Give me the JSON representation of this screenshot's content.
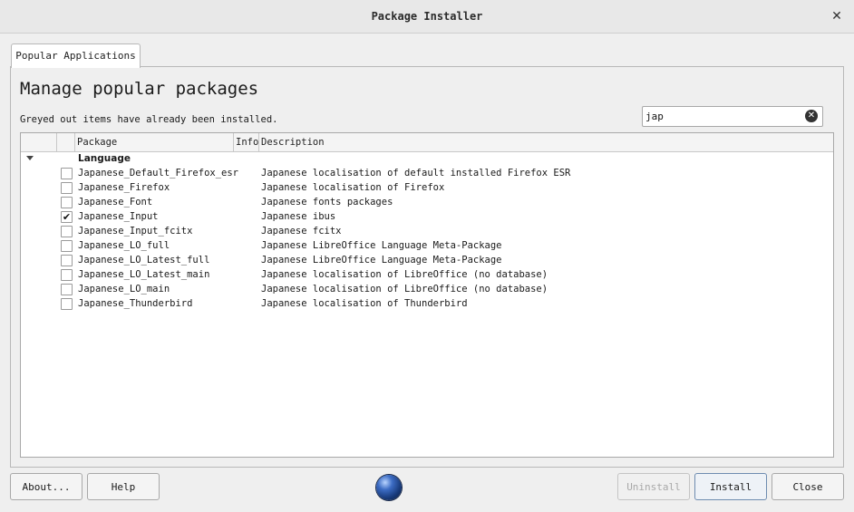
{
  "window": {
    "title": "Package Installer",
    "close_glyph": "✕"
  },
  "tab": {
    "label": "Popular Applications"
  },
  "main": {
    "heading": "Manage popular packages",
    "note": "Greyed out items have already been installed."
  },
  "search": {
    "value": "jap",
    "placeholder": ""
  },
  "table": {
    "columns": {
      "package": "Package",
      "info": "Info",
      "description": "Description"
    },
    "group": {
      "label": "Language",
      "expanded": true
    },
    "rows": [
      {
        "package": "Japanese_Default_Firefox_esr",
        "description": "Japanese localisation of default installed Firefox ESR",
        "checked": false
      },
      {
        "package": "Japanese_Firefox",
        "description": "Japanese localisation of Firefox",
        "checked": false
      },
      {
        "package": "Japanese_Font",
        "description": "Japanese fonts packages",
        "checked": false
      },
      {
        "package": "Japanese_Input",
        "description": "Japanese ibus",
        "checked": true
      },
      {
        "package": "Japanese_Input_fcitx",
        "description": "Japanese fcitx",
        "checked": false
      },
      {
        "package": "Japanese_LO_full",
        "description": "Japanese LibreOffice Language Meta-Package",
        "checked": false
      },
      {
        "package": "Japanese_LO_Latest_full",
        "description": "Japanese LibreOffice Language Meta-Package",
        "checked": false
      },
      {
        "package": "Japanese_LO_Latest_main",
        "description": "Japanese localisation of LibreOffice (no database)",
        "checked": false
      },
      {
        "package": "Japanese_LO_main",
        "description": "Japanese localisation of LibreOffice (no database)",
        "checked": false
      },
      {
        "package": "Japanese_Thunderbird",
        "description": "Japanese localisation of Thunderbird",
        "checked": false
      }
    ]
  },
  "buttons": {
    "about": "About...",
    "help": "Help",
    "uninstall": "Uninstall",
    "install": "Install",
    "close": "Close"
  },
  "icons": {
    "globe": "globe-icon",
    "clear": "clear-search-icon",
    "check_glyph": "✔"
  }
}
